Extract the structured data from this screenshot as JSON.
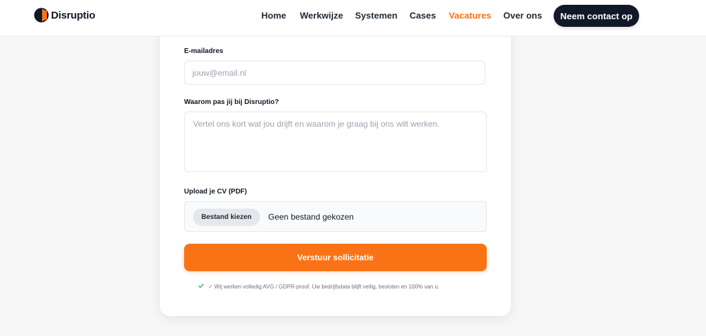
{
  "brand": {
    "name": "Disruptio",
    "colors": {
      "accent": "#f97316",
      "dark": "#111827"
    }
  },
  "nav": {
    "links": [
      {
        "label": "Home",
        "active": false
      },
      {
        "label": "Werkwijze",
        "active": false
      },
      {
        "label": "Systemen",
        "active": false
      },
      {
        "label": "Cases",
        "active": false
      },
      {
        "label": "Vacatures",
        "active": true
      },
      {
        "label": "Over ons",
        "active": false
      }
    ],
    "cta_label": "Neem contact op"
  },
  "form": {
    "email": {
      "label": "E-mailadres",
      "placeholder": "jouw@email.nl",
      "value": ""
    },
    "motivation": {
      "label": "Waarom pas jij bij Disruptio?",
      "placeholder": "Vertel ons kort wat jou drijft en waarom je graag bij ons wilt werken.",
      "value": ""
    },
    "cv": {
      "label": "Upload je CV (PDF)",
      "button_label": "Bestand kiezen",
      "status": "Geen bestand gekozen"
    },
    "submit_label": "Verstuur sollicitatie",
    "gdpr": {
      "icon": "checkmark-icon",
      "text": "✓ Wij werken volledig AVG / GDPR-proof. Uw bedrijfsdata blijft veilig, besloten en 100% van u."
    }
  }
}
